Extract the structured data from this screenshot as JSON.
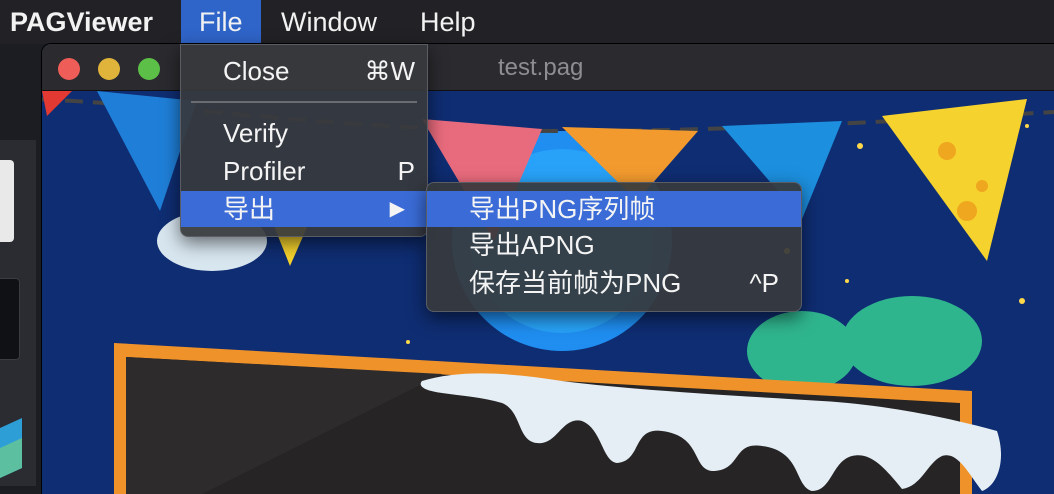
{
  "menubar": {
    "app_name": "PAGViewer",
    "items": [
      "File",
      "Window",
      "Help"
    ]
  },
  "window": {
    "title": "test.pag"
  },
  "file_menu": {
    "items": [
      {
        "label": "Close",
        "shortcut": "⌘W"
      },
      {
        "label": "Verify",
        "shortcut": ""
      },
      {
        "label": "Profiler",
        "shortcut": "P"
      },
      {
        "label": "导出",
        "shortcut": "▶"
      }
    ]
  },
  "export_submenu": {
    "items": [
      {
        "label": "导出PNG序列帧",
        "shortcut": ""
      },
      {
        "label": "导出APNG",
        "shortcut": ""
      },
      {
        "label": "保存当前帧为PNG",
        "shortcut": "^P"
      }
    ]
  },
  "colors": {
    "highlight": "#3a6bd6",
    "menu_bg": "#37393c",
    "canvas_bg": "#0e2b6b"
  }
}
